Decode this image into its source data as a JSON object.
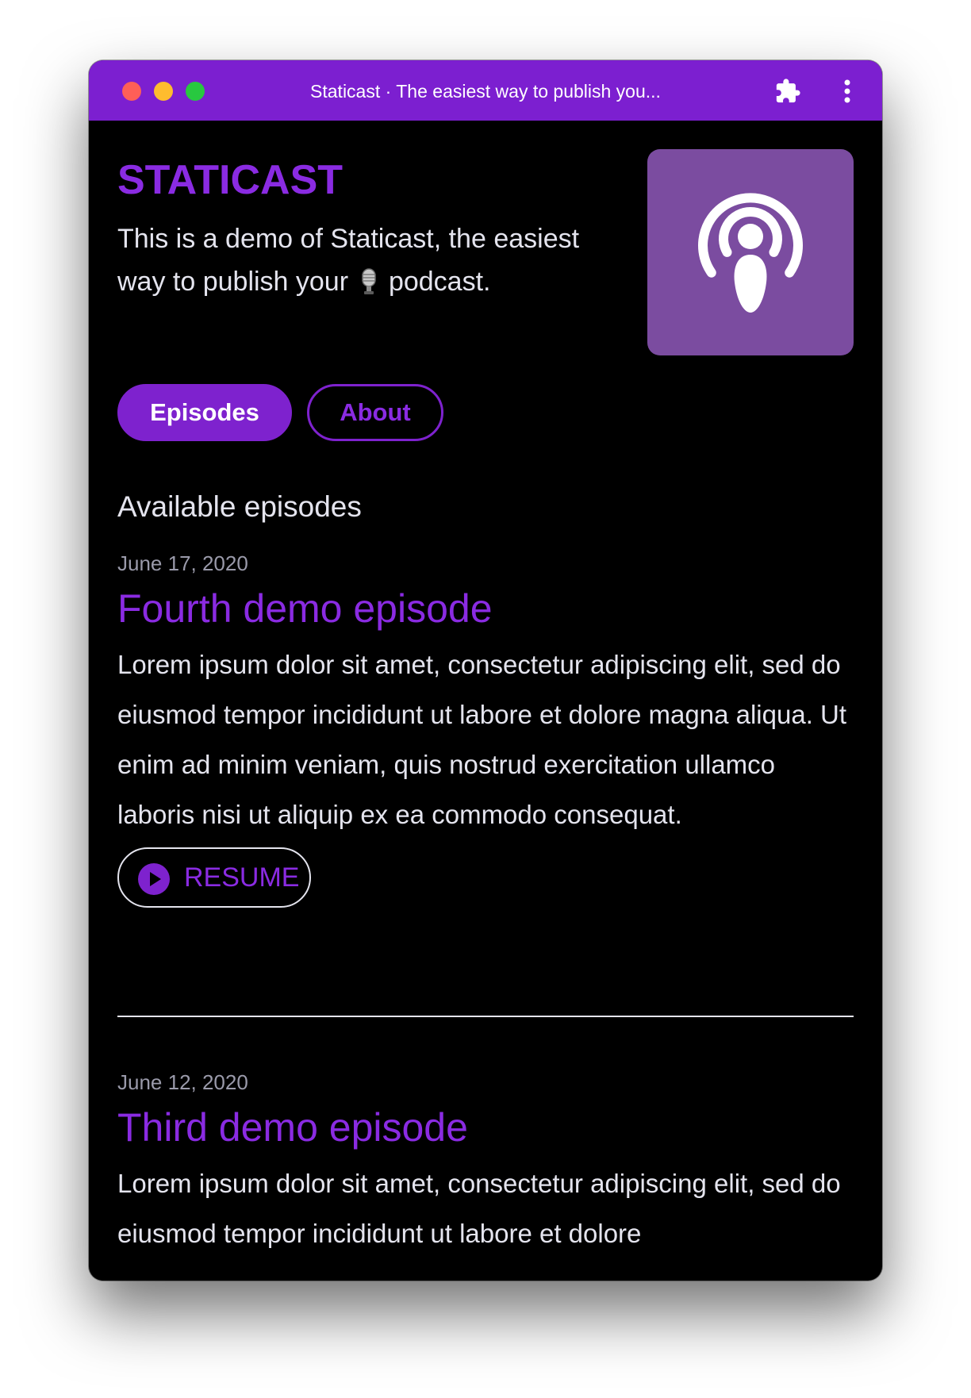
{
  "browser": {
    "tab_title": "Staticast · The easiest way to publish you...",
    "extension_icon": "puzzle-piece-icon",
    "menu_icon": "vertical-ellipsis-icon"
  },
  "site": {
    "title": "STATICAST",
    "tagline_before": "This is a demo of Staticast, the easiest way to publish your",
    "tagline_emoji": "microphone-icon",
    "tagline_after": "podcast.",
    "cover_icon": "podcast-icon"
  },
  "nav": {
    "episodes_label": "Episodes",
    "about_label": "About"
  },
  "main": {
    "heading": "Available episodes",
    "episodes": [
      {
        "date": "June 17, 2020",
        "title": "Fourth demo episode",
        "description": "Lorem ipsum dolor sit amet, consectetur adipiscing elit, sed do eiusmod tempor incididunt ut labore et dolore magna aliqua. Ut enim ad minim veniam, quis nostrud exercitation ullamco laboris nisi ut aliquip ex ea commodo consequat.",
        "action_label": "RESUME"
      },
      {
        "date": "June 12, 2020",
        "title": "Third demo episode",
        "description": "Lorem ipsum dolor sit amet, consectetur adipiscing elit, sed do eiusmod tempor incididunt ut labore et dolore"
      }
    ]
  },
  "colors": {
    "accent": "#7e22ce",
    "title_purple": "#8a2be2",
    "cover_background": "#7b4ca0",
    "text": "#e4e4ee",
    "muted_text": "#9a9aaa",
    "page_background": "#000000"
  }
}
